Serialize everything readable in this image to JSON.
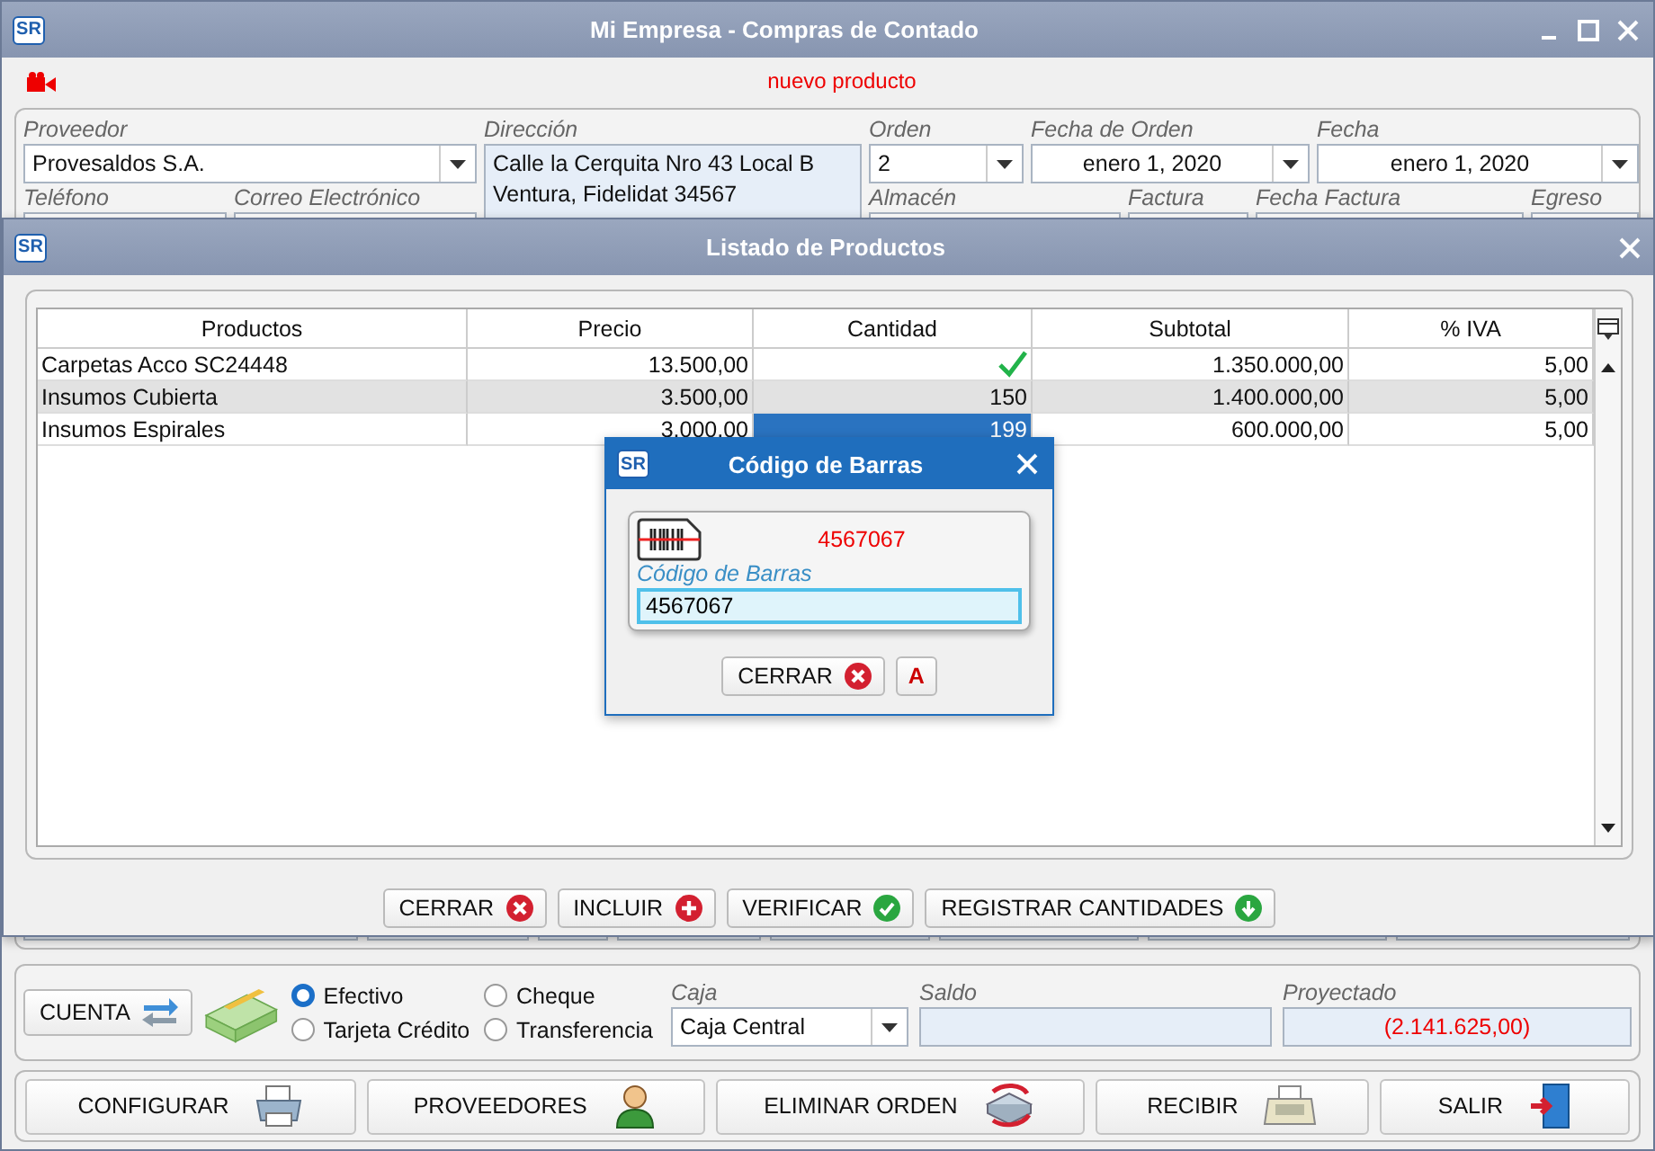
{
  "window": {
    "logo": "SR",
    "title": "Mi Empresa - Compras de Contado"
  },
  "toolbar": {
    "status": "nuevo producto"
  },
  "header": {
    "proveedor": {
      "label": "Proveedor",
      "value": "Provesaldos S.A."
    },
    "telefono": {
      "label": "Teléfono"
    },
    "correo": {
      "label": "Correo Electrónico"
    },
    "direccion": {
      "label": "Dirección",
      "lines": [
        "Calle la Cerquita Nro 43 Local B",
        "Ventura, Fidelidat 34567"
      ]
    },
    "orden": {
      "label": "Orden",
      "value": "2"
    },
    "fecha_orden": {
      "label": "Fecha de Orden",
      "value": "enero 1, 2020"
    },
    "fecha": {
      "label": "Fecha",
      "value": "enero 1, 2020"
    },
    "almacen": {
      "label": "Almacén"
    },
    "factura": {
      "label": "Factura"
    },
    "fecha_factura": {
      "label": "Fecha Factura"
    },
    "egreso": {
      "label": "Egreso"
    }
  },
  "products_dialog": {
    "logo": "SR",
    "title": "Listado de Productos",
    "columns": [
      "Productos",
      "Precio",
      "Cantidad",
      "Subtotal",
      "% IVA"
    ],
    "rows": [
      {
        "producto": "Carpetas Acco SC24448",
        "precio": "13.500,00",
        "cantidad": "",
        "verified": true,
        "subtotal": "1.350.000,00",
        "iva": "5,00",
        "selected": false,
        "editing": false
      },
      {
        "producto": "Insumos Cubierta",
        "precio": "3.500,00",
        "cantidad": "150",
        "verified": false,
        "subtotal": "1.400.000,00",
        "iva": "5,00",
        "selected": true,
        "editing": false
      },
      {
        "producto": "Insumos Espirales",
        "precio": "3.000,00",
        "cantidad": "199",
        "verified": false,
        "subtotal": "600.000,00",
        "iva": "5,00",
        "selected": false,
        "editing": true
      }
    ],
    "buttons": [
      {
        "label": "CERRAR",
        "kind": "close"
      },
      {
        "label": "INCLUIR",
        "kind": "add"
      },
      {
        "label": "VERIFICAR",
        "kind": "check"
      },
      {
        "label": "REGISTRAR CANTIDADES",
        "kind": "down"
      }
    ]
  },
  "barcode_dialog": {
    "logo": "SR",
    "title": "Código de Barras",
    "code": "4567067",
    "field_label": "Código de Barras",
    "value": "4567067",
    "buttons": [
      {
        "label": "CERRAR",
        "kind": "close"
      },
      {
        "label": "A",
        "kind": "letter"
      }
    ]
  },
  "payment": {
    "account_button": "CUENTA",
    "options": [
      {
        "label": "Efectivo",
        "selected": true
      },
      {
        "label": "Cheque",
        "selected": false
      },
      {
        "label": "Tarjeta Crédito",
        "selected": false
      },
      {
        "label": "Transferencia",
        "selected": false
      }
    ],
    "caja": {
      "label": "Caja",
      "value": "Caja Central"
    },
    "saldo": {
      "label": "Saldo"
    },
    "proyectado": {
      "label": "Proyectado",
      "value": "(2.141.625,00)"
    }
  },
  "actions": [
    {
      "label": "CONFIGURAR",
      "kind": "printer"
    },
    {
      "label": "PROVEEDORES",
      "kind": "person"
    },
    {
      "label": "ELIMINAR ORDEN",
      "kind": "delete"
    },
    {
      "label": "RECIBIR",
      "kind": "register"
    },
    {
      "label": "SALIR",
      "kind": "exit"
    }
  ]
}
